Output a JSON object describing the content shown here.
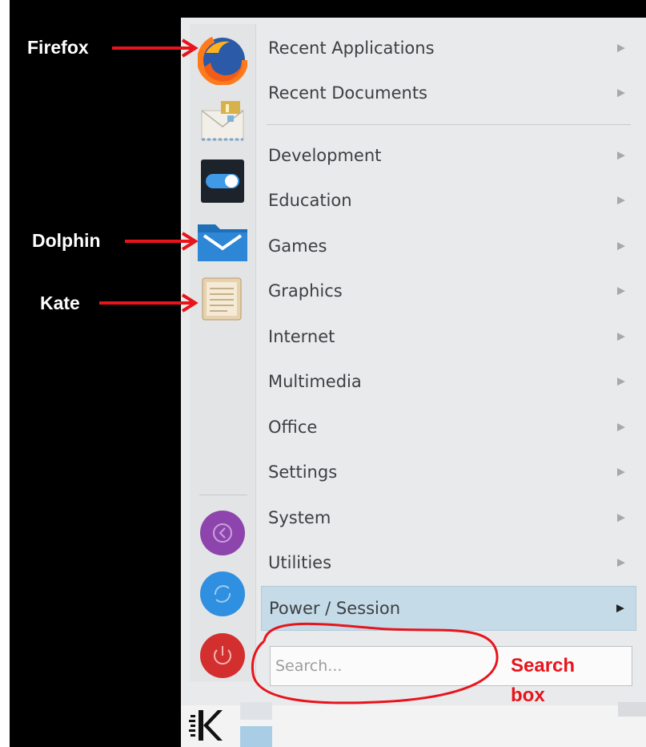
{
  "menu": {
    "categories": [
      {
        "label": "Recent Applications",
        "arrow": "▶"
      },
      {
        "label": "Recent Documents",
        "arrow": "▶"
      },
      {
        "label": "Development",
        "arrow": "▶"
      },
      {
        "label": "Education",
        "arrow": "▶"
      },
      {
        "label": "Games",
        "arrow": "▶"
      },
      {
        "label": "Graphics",
        "arrow": "▶"
      },
      {
        "label": "Internet",
        "arrow": "▶"
      },
      {
        "label": "Multimedia",
        "arrow": "▶"
      },
      {
        "label": "Office",
        "arrow": "▶"
      },
      {
        "label": "Settings",
        "arrow": "▶"
      },
      {
        "label": "System",
        "arrow": "▶"
      },
      {
        "label": "Utilities",
        "arrow": "▶"
      },
      {
        "label": "Power / Session",
        "arrow": "▶"
      }
    ]
  },
  "favorites": [
    "firefox-icon",
    "mail-icon",
    "system-settings-icon",
    "dolphin-icon",
    "kate-icon"
  ],
  "session_buttons": [
    "lock-icon",
    "switch-user-icon",
    "shutdown-icon"
  ],
  "search": {
    "placeholder": "Search..."
  },
  "annotations": {
    "firefox": "Firefox",
    "dolphin": "Dolphin",
    "kate": "Kate",
    "search_box_line1": "Search",
    "search_box_line2": "box"
  },
  "colors": {
    "annotation_red": "#e8141c",
    "active_item": "#c5dbe8",
    "menu_bg": "#e9eaeb"
  }
}
